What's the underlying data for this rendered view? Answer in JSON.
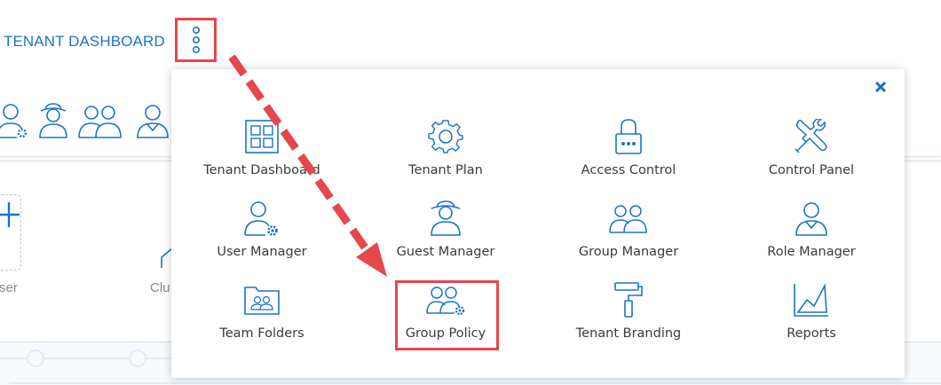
{
  "header": {
    "title": "TENANT DASHBOARD"
  },
  "background": {
    "label_user_partial": "ser",
    "label_cluster_partial": "Clu"
  },
  "popup": {
    "close_icon": "close-icon",
    "items": [
      {
        "label": "Tenant Dashboard",
        "icon": "grid-icon"
      },
      {
        "label": "Tenant Plan",
        "icon": "gear-icon"
      },
      {
        "label": "Access Control",
        "icon": "lock-icon"
      },
      {
        "label": "Control Panel",
        "icon": "tools-icon"
      },
      {
        "label": "User Manager",
        "icon": "user-gear-icon"
      },
      {
        "label": "Guest Manager",
        "icon": "guest-icon"
      },
      {
        "label": "Group Manager",
        "icon": "group-icon"
      },
      {
        "label": "Role Manager",
        "icon": "role-icon"
      },
      {
        "label": "Team Folders",
        "icon": "team-folder-icon"
      },
      {
        "label": "Group Policy",
        "icon": "group-gear-icon"
      },
      {
        "label": "Tenant Branding",
        "icon": "paint-roller-icon"
      },
      {
        "label": "Reports",
        "icon": "chart-icon"
      }
    ]
  },
  "colors": {
    "accent": "#1a73c9",
    "highlight": "#e5474b"
  }
}
